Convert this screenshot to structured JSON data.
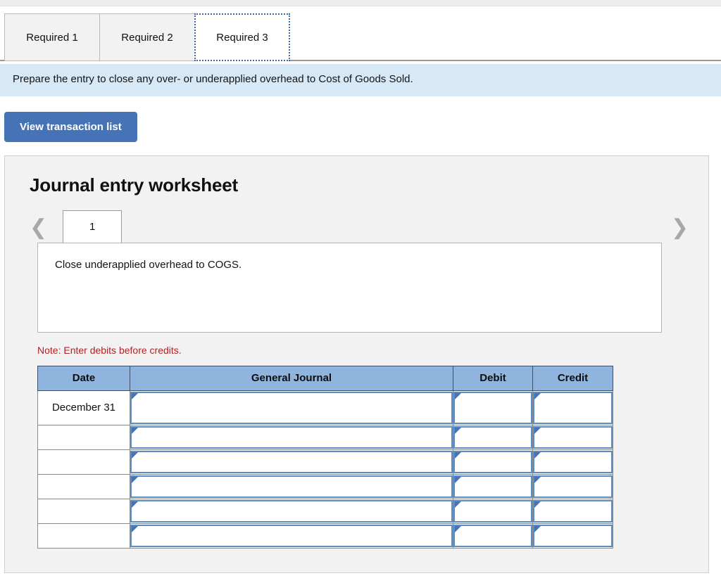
{
  "tabs": [
    {
      "label": "Required 1",
      "active": false
    },
    {
      "label": "Required 2",
      "active": false
    },
    {
      "label": "Required 3",
      "active": true
    }
  ],
  "instruction": "Prepare the entry to close any over- or underapplied overhead to Cost of Goods Sold.",
  "toolbar": {
    "view_transaction_list_label": "View transaction list"
  },
  "worksheet": {
    "title": "Journal entry worksheet",
    "prev_icon": "chevron-left-icon",
    "next_icon": "chevron-right-icon",
    "pages": [
      "1"
    ],
    "active_page": "1",
    "description": "Close underapplied overhead to COGS.",
    "note": "Note: Enter debits before credits."
  },
  "table": {
    "headers": [
      "Date",
      "General Journal",
      "Debit",
      "Credit"
    ],
    "rows": [
      {
        "date": "December 31",
        "general_journal": "",
        "debit": "",
        "credit": ""
      },
      {
        "date": "",
        "general_journal": "",
        "debit": "",
        "credit": ""
      },
      {
        "date": "",
        "general_journal": "",
        "debit": "",
        "credit": ""
      },
      {
        "date": "",
        "general_journal": "",
        "debit": "",
        "credit": ""
      },
      {
        "date": "",
        "general_journal": "",
        "debit": "",
        "credit": ""
      },
      {
        "date": "",
        "general_journal": "",
        "debit": "",
        "credit": ""
      }
    ]
  },
  "colors": {
    "accent_blue": "#4573b5",
    "header_blue": "#8fb4de",
    "instruction_bg": "#d7e8f7",
    "note_red": "#b22222",
    "panel_bg": "#f2f2f2"
  }
}
